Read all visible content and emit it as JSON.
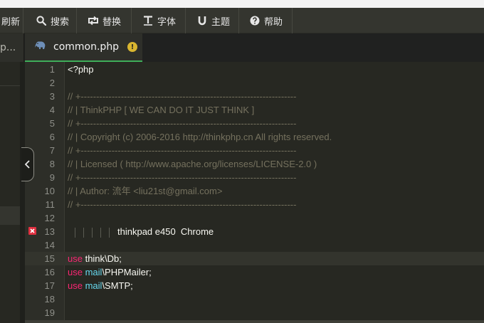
{
  "toolbar": {
    "refresh_label": "刷新",
    "search_label": "搜索",
    "replace_label": "替换",
    "font_label": "字体",
    "theme_label": "主题",
    "help_label": "帮助"
  },
  "tabs": {
    "prev_label": "p...",
    "active_label": "common.php",
    "warn_symbol": "!"
  },
  "editor": {
    "lines": [
      {
        "n": "1",
        "parts": [
          {
            "t": "<?php",
            "c": ""
          }
        ]
      },
      {
        "n": "2",
        "parts": []
      },
      {
        "n": "3",
        "parts": [
          {
            "t": "// +----------------------------------------------------------------------",
            "c": "cmt"
          }
        ]
      },
      {
        "n": "4",
        "parts": [
          {
            "t": "// | ThinkPHP [ WE CAN DO IT JUST THINK ]",
            "c": "cmt"
          }
        ]
      },
      {
        "n": "5",
        "parts": [
          {
            "t": "// +----------------------------------------------------------------------",
            "c": "cmt"
          }
        ]
      },
      {
        "n": "6",
        "parts": [
          {
            "t": "// | Copyright (c) 2006-2016 http://thinkphp.cn All rights reserved.",
            "c": "cmt"
          }
        ]
      },
      {
        "n": "7",
        "parts": [
          {
            "t": "// +----------------------------------------------------------------------",
            "c": "cmt"
          }
        ]
      },
      {
        "n": "8",
        "parts": [
          {
            "t": "// | Licensed ( http://www.apache.org/licenses/LICENSE-2.0 )",
            "c": "cmt"
          }
        ]
      },
      {
        "n": "9",
        "parts": [
          {
            "t": "// +----------------------------------------------------------------------",
            "c": "cmt"
          }
        ]
      },
      {
        "n": "10",
        "parts": [
          {
            "t": "// | Author: 流年 <liu21st@gmail.com>",
            "c": "cmt"
          }
        ]
      },
      {
        "n": "11",
        "parts": [
          {
            "t": "// +----------------------------------------------------------------------",
            "c": "cmt"
          }
        ]
      },
      {
        "n": "12",
        "parts": []
      },
      {
        "n": "13",
        "error": true,
        "guides": 5,
        "parts": [
          {
            "t": "thinkpad e450  Chrome",
            "c": ""
          }
        ]
      },
      {
        "n": "14",
        "parts": []
      },
      {
        "n": "15",
        "highlight": true,
        "parts": [
          {
            "t": "use",
            "c": "kw"
          },
          {
            "t": " think\\Db;",
            "c": ""
          }
        ]
      },
      {
        "n": "16",
        "parts": [
          {
            "t": "use",
            "c": "kw"
          },
          {
            "t": " ",
            "c": ""
          },
          {
            "t": "mail",
            "c": "ns"
          },
          {
            "t": "\\PHPMailer;",
            "c": ""
          }
        ]
      },
      {
        "n": "17",
        "parts": [
          {
            "t": "use",
            "c": "kw"
          },
          {
            "t": " ",
            "c": ""
          },
          {
            "t": "mail",
            "c": "ns"
          },
          {
            "t": "\\SMTP;",
            "c": ""
          }
        ]
      },
      {
        "n": "18",
        "parts": []
      },
      {
        "n": "19",
        "parts": []
      }
    ]
  },
  "colors": {
    "bg": "#272822",
    "keyword": "#f92672",
    "namespace": "#66d9ef",
    "comment": "#75715e",
    "active_tab_accent": "#3fae5a",
    "error": "#e03040",
    "warning": "#d9b630"
  }
}
